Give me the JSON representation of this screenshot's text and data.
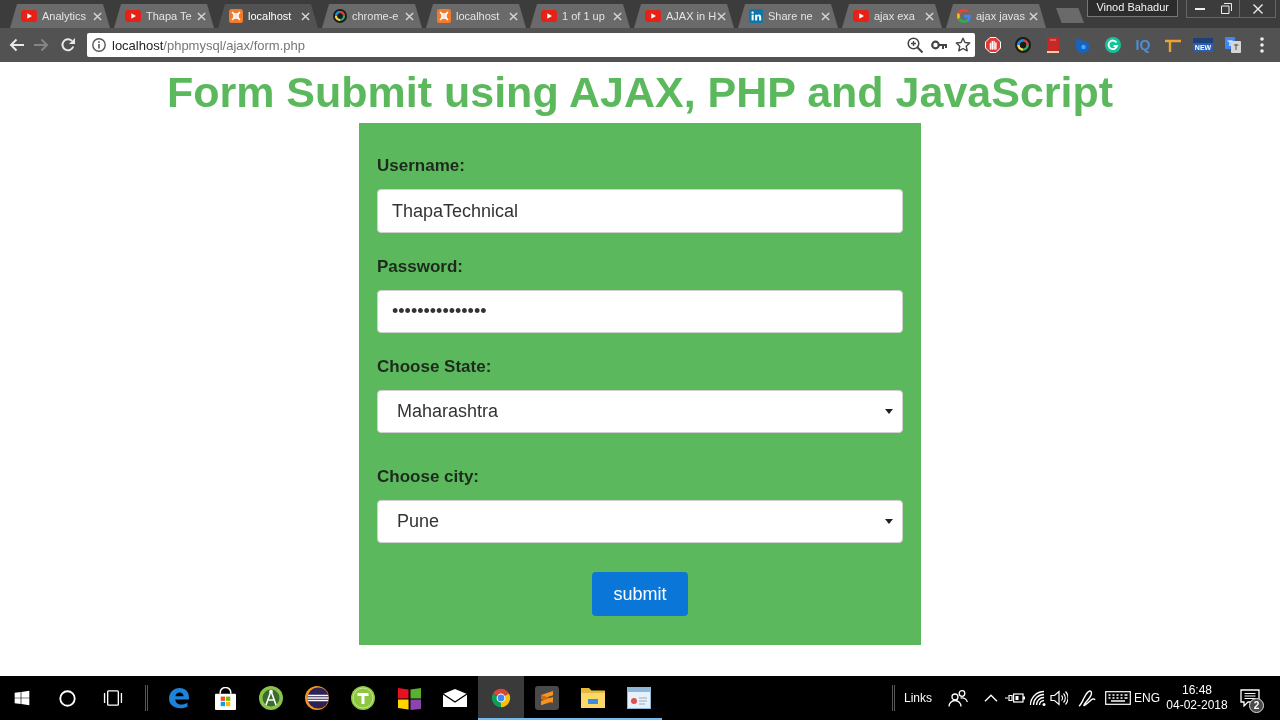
{
  "browser": {
    "tabs": [
      {
        "kind": "video",
        "label": "Analytics",
        "selected": false
      },
      {
        "kind": "video",
        "label": "Thapa Te",
        "selected": false
      },
      {
        "kind": "server",
        "label": "localhost",
        "selected": true
      },
      {
        "kind": "ring",
        "label": "chrome-e",
        "selected": false
      },
      {
        "kind": "server",
        "label": "localhost",
        "selected": false
      },
      {
        "kind": "video",
        "label": "1 of 1 up",
        "selected": false
      },
      {
        "kind": "video",
        "label": "AJAX in H",
        "selected": false
      },
      {
        "kind": "network",
        "label": "Share ne",
        "selected": false
      },
      {
        "kind": "video",
        "label": "ajax exa",
        "selected": false
      },
      {
        "kind": "search",
        "label": "ajax javas",
        "selected": false
      }
    ],
    "profile": "Vinod Bahadur",
    "toolbar": {
      "back_disabled": false,
      "forward_disabled": true,
      "url": {
        "host": "localhost",
        "path": "/phpmysql/ajax/form.php"
      },
      "extensions": [
        {
          "kind": "stop"
        },
        {
          "kind": "ring"
        },
        {
          "kind": "book"
        },
        {
          "kind": "blob"
        },
        {
          "kind": "gcircle"
        },
        {
          "kind": "text",
          "label": "IQ"
        },
        {
          "kind": "tsquare"
        },
        {
          "kind": "badge",
          "label": "NEW"
        },
        {
          "kind": "translate"
        }
      ]
    }
  },
  "page": {
    "title": "Form Submit using AJAX, PHP and JavaScript",
    "form": {
      "fields": [
        {
          "kind": "text",
          "label": "Username:",
          "value": "ThapaTechnical"
        },
        {
          "kind": "password",
          "label": "Password:",
          "value": "•••••••••••••••"
        },
        {
          "kind": "select",
          "label": "Choose State:",
          "value": "Maharashtra"
        },
        {
          "kind": "select",
          "label": "Choose city:",
          "value": "Pune"
        }
      ],
      "submit": "submit"
    }
  },
  "taskbar": {
    "apps": [
      {
        "kind": "edge",
        "selected": false,
        "running": false
      },
      {
        "kind": "store",
        "selected": false,
        "running": false
      },
      {
        "kind": "android",
        "selected": false,
        "running": false
      },
      {
        "kind": "eclipse",
        "selected": false,
        "running": false
      },
      {
        "kind": "tapp",
        "selected": false,
        "running": false
      },
      {
        "kind": "tiles",
        "selected": false,
        "running": false
      },
      {
        "kind": "mail",
        "selected": false,
        "running": false
      },
      {
        "kind": "chrome",
        "selected": true,
        "running": true
      },
      {
        "kind": "sublime",
        "selected": false,
        "running": true
      },
      {
        "kind": "folder",
        "selected": false,
        "running": true
      },
      {
        "kind": "window",
        "selected": false,
        "running": true
      }
    ],
    "tray": {
      "links": "Links",
      "language": "ENG",
      "time": "16:48",
      "date": "04-02-2018",
      "notifications": "2"
    }
  }
}
